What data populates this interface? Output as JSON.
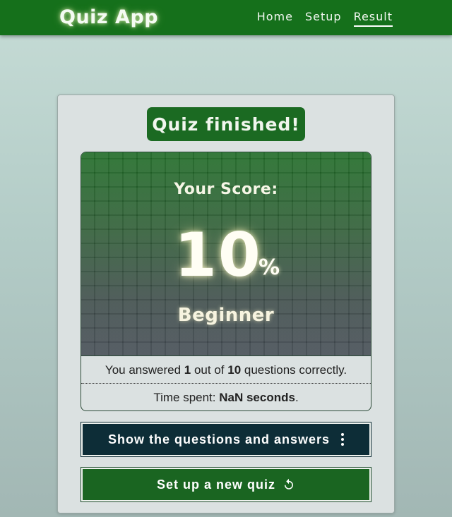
{
  "header": {
    "brand": "Quiz App",
    "nav": {
      "home": "Home",
      "setup": "Setup",
      "result": "Result",
      "active": "Result"
    }
  },
  "result": {
    "finished_label": "Quiz finished!",
    "score_title": "Your Score:",
    "score_value": "10",
    "score_unit": "%",
    "level": "Beginner",
    "answered_prefix": "You answered ",
    "correct_count": "1",
    "answered_middle": " out of ",
    "total_count": "10",
    "answered_suffix": " questions correctly.",
    "time_prefix": "Time spent: ",
    "time_value": "NaN seconds",
    "time_suffix": "."
  },
  "actions": {
    "show_answers_label": "Show the questions and answers",
    "show_answers_icon": "kebab-menu-icon",
    "new_quiz_label": "Set up a new quiz",
    "new_quiz_icon": "refresh-icon"
  },
  "colors": {
    "header_green": "#15701b",
    "accent_green": "#1b6a22",
    "dark_teal": "#0d2d37"
  }
}
